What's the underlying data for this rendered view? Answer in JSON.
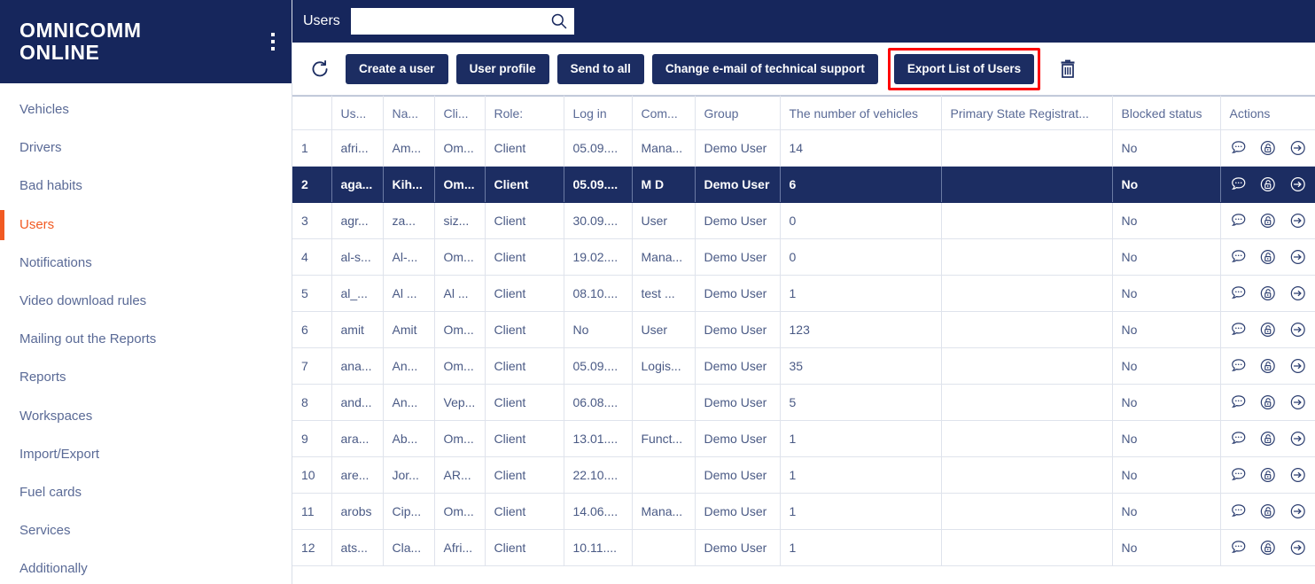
{
  "brand": {
    "line1": "OMNICOMM",
    "line2": "ONLINE",
    "menu_icon": "kebab-menu-icon"
  },
  "sidebar": {
    "items": [
      {
        "label": "Vehicles",
        "active": false
      },
      {
        "label": "Drivers",
        "active": false
      },
      {
        "label": "Bad habits",
        "active": false
      },
      {
        "label": "Users",
        "active": true
      },
      {
        "label": "Notifications",
        "active": false
      },
      {
        "label": "Video download rules",
        "active": false
      },
      {
        "label": "Mailing out the Reports",
        "active": false
      },
      {
        "label": "Reports",
        "active": false
      },
      {
        "label": "Workspaces",
        "active": false
      },
      {
        "label": "Import/Export",
        "active": false
      },
      {
        "label": "Fuel cards",
        "active": false
      },
      {
        "label": "Services",
        "active": false
      },
      {
        "label": "Additionally",
        "active": false
      }
    ],
    "active_color": "#f15a22",
    "item_color": "#5a6a96"
  },
  "topbar": {
    "title": "Users",
    "search_value": "",
    "search_placeholder": "",
    "search_icon": "search-icon",
    "background": "#16265c"
  },
  "toolbar": {
    "refresh_icon": "refresh-icon",
    "delete_icon": "trash-icon",
    "buttons": [
      {
        "label": "Create a user",
        "highlighted": false
      },
      {
        "label": "User profile",
        "highlighted": false
      },
      {
        "label": "Send to all",
        "highlighted": false
      },
      {
        "label": "Change e-mail of technical support",
        "highlighted": false
      },
      {
        "label": "Export List of Users",
        "highlighted": true
      }
    ],
    "highlight_color": "#ff0000",
    "button_color": "#1c2d62"
  },
  "table": {
    "headers": [
      "",
      "Us...",
      "Na...",
      "Cli...",
      "Role:",
      "Log in",
      "Com...",
      "Group",
      "The number of vehicles",
      "Primary State Registrat...",
      "Blocked status",
      "Actions"
    ],
    "action_icons": [
      "comment-icon",
      "unlock-icon",
      "login-as-icon"
    ],
    "selected_row_index": 1,
    "selected_row_color": "#1c2d62",
    "rows": [
      {
        "num": "1",
        "user": "afri...",
        "name": "Am...",
        "client": "Om...",
        "role": "Client",
        "login": "05.09....",
        "company": "Mana...",
        "group": "Demo User",
        "vehicles": "14",
        "psrn": "",
        "blocked": "No",
        "selected": false
      },
      {
        "num": "2",
        "user": "aga...",
        "name": "Kih...",
        "client": "Om...",
        "role": "Client",
        "login": "05.09....",
        "company": "M D",
        "group": "Demo User",
        "vehicles": "6",
        "psrn": "",
        "blocked": "No",
        "selected": true
      },
      {
        "num": "3",
        "user": "agr...",
        "name": "za...",
        "client": "siz...",
        "role": "Client",
        "login": "30.09....",
        "company": "User",
        "group": "Demo User",
        "vehicles": "0",
        "psrn": "",
        "blocked": "No",
        "selected": false
      },
      {
        "num": "4",
        "user": "al-s...",
        "name": "Al-...",
        "client": "Om...",
        "role": "Client",
        "login": "19.02....",
        "company": "Mana...",
        "group": "Demo User",
        "vehicles": "0",
        "psrn": "",
        "blocked": "No",
        "selected": false
      },
      {
        "num": "5",
        "user": "al_...",
        "name": "Al ...",
        "client": "Al ...",
        "role": "Client",
        "login": "08.10....",
        "company": "test ...",
        "group": "Demo User",
        "vehicles": "1",
        "psrn": "",
        "blocked": "No",
        "selected": false
      },
      {
        "num": "6",
        "user": "amit",
        "name": "Amit",
        "client": "Om...",
        "role": "Client",
        "login": "No",
        "company": "User",
        "group": "Demo User",
        "vehicles": "123",
        "psrn": "",
        "blocked": "No",
        "selected": false
      },
      {
        "num": "7",
        "user": "ana...",
        "name": "An...",
        "client": "Om...",
        "role": "Client",
        "login": "05.09....",
        "company": "Logis...",
        "group": "Demo User",
        "vehicles": "35",
        "psrn": "",
        "blocked": "No",
        "selected": false
      },
      {
        "num": "8",
        "user": "and...",
        "name": "An...",
        "client": "Vep...",
        "role": "Client",
        "login": "06.08....",
        "company": "",
        "group": "Demo User",
        "vehicles": "5",
        "psrn": "",
        "blocked": "No",
        "selected": false
      },
      {
        "num": "9",
        "user": "ara...",
        "name": "Ab...",
        "client": "Om...",
        "role": "Client",
        "login": "13.01....",
        "company": "Funct...",
        "group": "Demo User",
        "vehicles": "1",
        "psrn": "",
        "blocked": "No",
        "selected": false
      },
      {
        "num": "10",
        "user": "are...",
        "name": "Jor...",
        "client": "AR...",
        "role": "Client",
        "login": "22.10....",
        "company": "",
        "group": "Demo User",
        "vehicles": "1",
        "psrn": "",
        "blocked": "No",
        "selected": false
      },
      {
        "num": "11",
        "user": "arobs",
        "name": "Cip...",
        "client": "Om...",
        "role": "Client",
        "login": "14.06....",
        "company": "Mana...",
        "group": "Demo User",
        "vehicles": "1",
        "psrn": "",
        "blocked": "No",
        "selected": false
      },
      {
        "num": "12",
        "user": "ats...",
        "name": "Cla...",
        "client": "Afri...",
        "role": "Client",
        "login": "10.11....",
        "company": "",
        "group": "Demo User",
        "vehicles": "1",
        "psrn": "",
        "blocked": "No",
        "selected": false
      }
    ]
  }
}
